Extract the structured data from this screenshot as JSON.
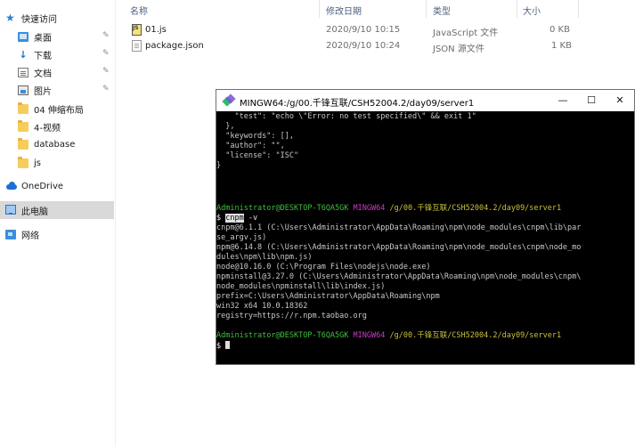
{
  "sidebar": {
    "items": [
      {
        "label": "快速访问"
      },
      {
        "label": "桌面"
      },
      {
        "label": "下载"
      },
      {
        "label": "文档"
      },
      {
        "label": "图片"
      },
      {
        "label": "04 伸缩布局"
      },
      {
        "label": "4-视频"
      },
      {
        "label": "database"
      },
      {
        "label": "js"
      },
      {
        "label": "OneDrive"
      },
      {
        "label": "此电脑"
      },
      {
        "label": "网络"
      }
    ]
  },
  "list": {
    "headers": {
      "name": "名称",
      "date": "修改日期",
      "type": "类型",
      "size": "大小"
    },
    "files": [
      {
        "name": "01.js",
        "date": "2020/9/10 10:15",
        "type": "JavaScript 文件",
        "size": "0 KB"
      },
      {
        "name": "package.json",
        "date": "2020/9/10 10:24",
        "type": "JSON 源文件",
        "size": "1 KB"
      }
    ]
  },
  "terminal": {
    "title": "MINGW64:/g/00.千锋互联/CSH52004.2/day09/server1",
    "buttons": {
      "minimize": "—",
      "maximize": "☐",
      "close": "✕"
    },
    "json_tail": [
      "    \"test\": \"echo \\\"Error: no test specified\\\" && exit 1\"",
      "  },",
      "  \"keywords\": [],",
      "  \"author\": \"\",",
      "  \"license\": \"ISC\"",
      "}"
    ],
    "prompt": {
      "user": "Administrator@DESKTOP-T6QA5GK",
      "shell": "MINGW64",
      "path": "/g/00.千锋互联/CSH52004.2/day09/server1"
    },
    "command": {
      "prefix": "$ ",
      "highlighted": "cnpm",
      "rest": " -v"
    },
    "output": [
      "cnpm@6.1.1 (C:\\Users\\Administrator\\AppData\\Roaming\\npm\\node_modules\\cnpm\\lib\\par",
      "se_argv.js)",
      "npm@6.14.8 (C:\\Users\\Administrator\\AppData\\Roaming\\npm\\node_modules\\cnpm\\node_mo",
      "dules\\npm\\lib\\npm.js)",
      "node@10.16.0 (C:\\Program Files\\nodejs\\node.exe)",
      "npminstall@3.27.0 (C:\\Users\\Administrator\\AppData\\Roaming\\npm\\node_modules\\cnpm\\",
      "node_modules\\npminstall\\lib\\index.js)",
      "prefix=C:\\Users\\Administrator\\AppData\\Roaming\\npm",
      "win32 x64 10.0.18362",
      "registry=https://r.npm.taobao.org"
    ],
    "final_prompt_symbol": "$ "
  }
}
